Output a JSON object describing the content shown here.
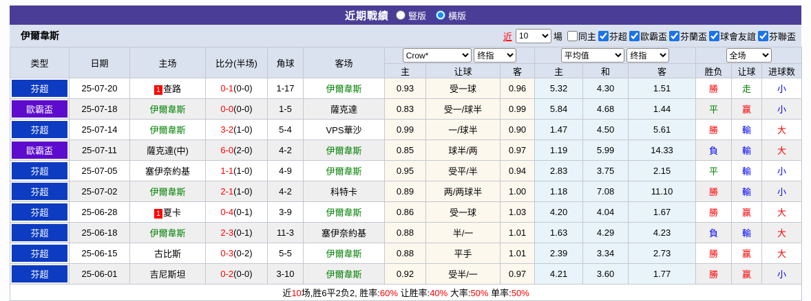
{
  "colors": {
    "header_purple": "#4a3d97",
    "panel_bg": "#dbe2ef",
    "league_blue": "#0d3cc2",
    "league_purple": "#5d0bcd",
    "red": "#ff0000",
    "green": "#008000",
    "blue": "#0000ff",
    "odds_bg": "#fdf8ee",
    "avg_bg": "#e9f4fa",
    "alt_row_bg": "#efefef"
  },
  "title_bar": {
    "title": "近期戰績",
    "view_options": [
      {
        "label": "豎版",
        "checked": false
      },
      {
        "label": "橫版",
        "checked": true
      }
    ]
  },
  "filter": {
    "team_name": "伊爾韋斯",
    "near_label": "近",
    "count_value": "10",
    "games_label": "場",
    "same_home_label": "同主",
    "same_home_checked": false,
    "leagues": [
      {
        "label": "芬超",
        "checked": true
      },
      {
        "label": "歐霸盃",
        "checked": true
      },
      {
        "label": "芬蘭盃",
        "checked": true
      },
      {
        "label": "球會友誼",
        "checked": true
      },
      {
        "label": "芬聯盃",
        "checked": true
      }
    ]
  },
  "table": {
    "columns": {
      "type": "类型",
      "date": "日期",
      "home": "主场",
      "score": "比分(半场)",
      "corner": "角球",
      "away": "客场",
      "odds_home": "主",
      "odds_handicap": "让球",
      "odds_away": "客",
      "avg_home": "主",
      "avg_draw": "和",
      "avg_away": "客",
      "result_outcome": "胜负",
      "result_handicap": "让球",
      "result_goals": "进球数"
    },
    "selects": {
      "odds_source": "Crow*",
      "odds_period": "终指",
      "avg_source": "平均值",
      "avg_period": "终指",
      "scope": "全场"
    },
    "rows": [
      {
        "league": "芬超",
        "league_style": "blue",
        "date": "25-07-20",
        "home": {
          "name": "查路",
          "red_cards": "1",
          "is_subject": false
        },
        "score": {
          "full": "0-1",
          "half": "(0-0)"
        },
        "corner": "1-17",
        "away": {
          "name": "伊爾韋斯",
          "red_cards": "",
          "is_subject": true
        },
        "crow": {
          "home": "0.93",
          "handicap": "受一球",
          "away": "0.96"
        },
        "average": {
          "home": "5.32",
          "draw": "4.30",
          "away": "1.51"
        },
        "result": {
          "outcome": "勝",
          "outcome_color": "red",
          "handicap": "走",
          "handicap_color": "green",
          "goals": "小",
          "goals_color": "blue"
        }
      },
      {
        "league": "歐霸盃",
        "league_style": "purple",
        "date": "25-07-18",
        "home": {
          "name": "伊爾韋斯",
          "red_cards": "",
          "is_subject": true
        },
        "score": {
          "full": "0-0",
          "half": "(0-0)"
        },
        "corner": "1-5",
        "away": {
          "name": "薩克達",
          "red_cards": "",
          "is_subject": false
        },
        "crow": {
          "home": "0.83",
          "handicap": "受一/球半",
          "away": "0.99"
        },
        "average": {
          "home": "5.84",
          "draw": "4.68",
          "away": "1.44"
        },
        "result": {
          "outcome": "平",
          "outcome_color": "green",
          "handicap": "赢",
          "handicap_color": "red",
          "goals": "小",
          "goals_color": "blue"
        }
      },
      {
        "league": "芬超",
        "league_style": "blue",
        "date": "25-07-14",
        "home": {
          "name": "伊爾韋斯",
          "red_cards": "",
          "is_subject": true
        },
        "score": {
          "full": "3-2",
          "half": "(1-0)"
        },
        "corner": "5-4",
        "away": {
          "name": "VPS華沙",
          "red_cards": "",
          "is_subject": false
        },
        "crow": {
          "home": "0.99",
          "handicap": "一/球半",
          "away": "0.90"
        },
        "average": {
          "home": "1.47",
          "draw": "4.50",
          "away": "5.61"
        },
        "result": {
          "outcome": "勝",
          "outcome_color": "red",
          "handicap": "輸",
          "handicap_color": "blue",
          "goals": "大",
          "goals_color": "red"
        }
      },
      {
        "league": "歐霸盃",
        "league_style": "purple",
        "date": "25-07-11",
        "home": {
          "name": "薩克達(中)",
          "red_cards": "",
          "is_subject": false
        },
        "score": {
          "full": "6-0",
          "half": "(2-0)"
        },
        "corner": "4-2",
        "away": {
          "name": "伊爾韋斯",
          "red_cards": "",
          "is_subject": true
        },
        "crow": {
          "home": "0.85",
          "handicap": "球半/两",
          "away": "0.97"
        },
        "average": {
          "home": "1.19",
          "draw": "5.99",
          "away": "14.33"
        },
        "result": {
          "outcome": "負",
          "outcome_color": "blue",
          "handicap": "輸",
          "handicap_color": "blue",
          "goals": "大",
          "goals_color": "red"
        }
      },
      {
        "league": "芬超",
        "league_style": "blue",
        "date": "25-07-05",
        "home": {
          "name": "塞伊奈約基",
          "red_cards": "",
          "is_subject": false
        },
        "score": {
          "full": "1-1",
          "half": "(1-0)"
        },
        "corner": "4-9",
        "away": {
          "name": "伊爾韋斯",
          "red_cards": "",
          "is_subject": true
        },
        "crow": {
          "home": "0.95",
          "handicap": "受平/半",
          "away": "0.94"
        },
        "average": {
          "home": "2.83",
          "draw": "3.75",
          "away": "2.15"
        },
        "result": {
          "outcome": "平",
          "outcome_color": "green",
          "handicap": "輸",
          "handicap_color": "blue",
          "goals": "小",
          "goals_color": "blue"
        }
      },
      {
        "league": "芬超",
        "league_style": "blue",
        "date": "25-07-02",
        "home": {
          "name": "伊爾韋斯",
          "red_cards": "",
          "is_subject": true
        },
        "score": {
          "full": "2-1",
          "half": "(1-0)"
        },
        "corner": "4-2",
        "away": {
          "name": "科特卡",
          "red_cards": "",
          "is_subject": false
        },
        "crow": {
          "home": "0.89",
          "handicap": "两/两球半",
          "away": "1.00"
        },
        "average": {
          "home": "1.18",
          "draw": "7.08",
          "away": "11.10"
        },
        "result": {
          "outcome": "勝",
          "outcome_color": "red",
          "handicap": "輸",
          "handicap_color": "blue",
          "goals": "小",
          "goals_color": "blue"
        }
      },
      {
        "league": "芬超",
        "league_style": "blue",
        "date": "25-06-28",
        "home": {
          "name": "夏卡",
          "red_cards": "1",
          "is_subject": false
        },
        "score": {
          "full": "0-4",
          "half": "(0-1)"
        },
        "corner": "3-9",
        "away": {
          "name": "伊爾韋斯",
          "red_cards": "",
          "is_subject": true
        },
        "crow": {
          "home": "0.86",
          "handicap": "受一球",
          "away": "1.03"
        },
        "average": {
          "home": "4.20",
          "draw": "4.04",
          "away": "1.67"
        },
        "result": {
          "outcome": "勝",
          "outcome_color": "red",
          "handicap": "赢",
          "handicap_color": "red",
          "goals": "大",
          "goals_color": "red"
        }
      },
      {
        "league": "芬超",
        "league_style": "blue",
        "date": "25-06-18",
        "home": {
          "name": "伊爾韋斯",
          "red_cards": "",
          "is_subject": true
        },
        "score": {
          "full": "2-3",
          "half": "(0-1)"
        },
        "corner": "11-3",
        "away": {
          "name": "塞伊奈約基",
          "red_cards": "",
          "is_subject": false
        },
        "crow": {
          "home": "0.88",
          "handicap": "半/一",
          "away": "1.01"
        },
        "average": {
          "home": "1.63",
          "draw": "4.29",
          "away": "4.23"
        },
        "result": {
          "outcome": "負",
          "outcome_color": "blue",
          "handicap": "輸",
          "handicap_color": "blue",
          "goals": "大",
          "goals_color": "red"
        }
      },
      {
        "league": "芬超",
        "league_style": "blue",
        "date": "25-06-15",
        "home": {
          "name": "古比斯",
          "red_cards": "",
          "is_subject": false
        },
        "score": {
          "full": "0-3",
          "half": "(0-2)"
        },
        "corner": "5-5",
        "away": {
          "name": "伊爾韋斯",
          "red_cards": "",
          "is_subject": true
        },
        "crow": {
          "home": "0.88",
          "handicap": "平手",
          "away": "1.01"
        },
        "average": {
          "home": "2.39",
          "draw": "3.34",
          "away": "2.73"
        },
        "result": {
          "outcome": "勝",
          "outcome_color": "red",
          "handicap": "赢",
          "handicap_color": "red",
          "goals": "大",
          "goals_color": "red"
        }
      },
      {
        "league": "芬超",
        "league_style": "blue",
        "date": "25-06-01",
        "home": {
          "name": "吉尼斯坦",
          "red_cards": "",
          "is_subject": false
        },
        "score": {
          "full": "0-2",
          "half": "(0-0)"
        },
        "corner": "3-10",
        "away": {
          "name": "伊爾韋斯",
          "red_cards": "",
          "is_subject": true
        },
        "crow": {
          "home": "0.92",
          "handicap": "受半/一",
          "away": "0.97"
        },
        "average": {
          "home": "4.21",
          "draw": "3.60",
          "away": "1.77"
        },
        "result": {
          "outcome": "勝",
          "outcome_color": "red",
          "handicap": "赢",
          "handicap_color": "red",
          "goals": "小",
          "goals_color": "blue"
        }
      }
    ]
  },
  "summary": {
    "segments": [
      {
        "text": "近",
        "color": "black"
      },
      {
        "text": "10",
        "color": "red"
      },
      {
        "text": "场,胜6平2负2, 胜率:",
        "color": "black"
      },
      {
        "text": "60%",
        "color": "red"
      },
      {
        "text": " 让胜率:",
        "color": "black"
      },
      {
        "text": "40%",
        "color": "red"
      },
      {
        "text": " 大率:",
        "color": "black"
      },
      {
        "text": "50%",
        "color": "red"
      },
      {
        "text": " 单率:",
        "color": "black"
      },
      {
        "text": "50%",
        "color": "red"
      }
    ]
  }
}
